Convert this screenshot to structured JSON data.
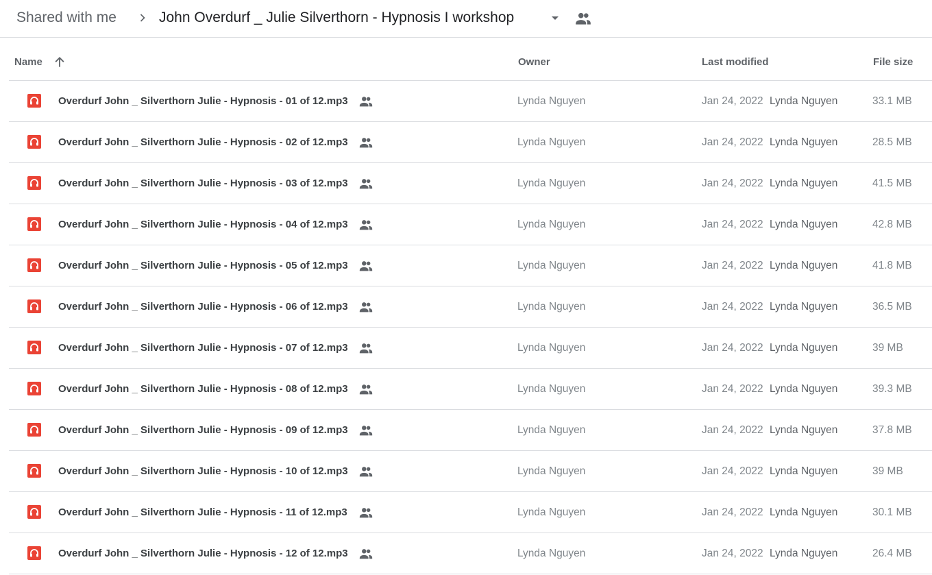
{
  "breadcrumb": {
    "root": "Shared with me",
    "current": "John Overdurf _ Julie Silverthorn - Hypnosis I workshop",
    "separator_icon": "chevron-right-icon",
    "dropdown_icon": "arrow-drop-down-icon",
    "shared_icon": "people-icon"
  },
  "columns": {
    "name": "Name",
    "owner": "Owner",
    "last_modified": "Last modified",
    "file_size": "File size",
    "sort_icon": "arrow-up-icon"
  },
  "colors": {
    "audio_icon": "#ea4335",
    "divider": "#dadce0"
  },
  "files": [
    {
      "name": "Overdurf John _ Silverthorn Julie - Hypnosis - 01 of 12.mp3",
      "owner": "Lynda Nguyen",
      "date": "Jan 24, 2022",
      "modified_by": "Lynda Nguyen",
      "size": "33.1 MB"
    },
    {
      "name": "Overdurf John _ Silverthorn Julie - Hypnosis - 02 of 12.mp3",
      "owner": "Lynda Nguyen",
      "date": "Jan 24, 2022",
      "modified_by": "Lynda Nguyen",
      "size": "28.5 MB"
    },
    {
      "name": "Overdurf John _ Silverthorn Julie - Hypnosis - 03 of 12.mp3",
      "owner": "Lynda Nguyen",
      "date": "Jan 24, 2022",
      "modified_by": "Lynda Nguyen",
      "size": "41.5 MB"
    },
    {
      "name": "Overdurf John _ Silverthorn Julie - Hypnosis - 04 of 12.mp3",
      "owner": "Lynda Nguyen",
      "date": "Jan 24, 2022",
      "modified_by": "Lynda Nguyen",
      "size": "42.8 MB"
    },
    {
      "name": "Overdurf John _ Silverthorn Julie - Hypnosis - 05 of 12.mp3",
      "owner": "Lynda Nguyen",
      "date": "Jan 24, 2022",
      "modified_by": "Lynda Nguyen",
      "size": "41.8 MB"
    },
    {
      "name": "Overdurf John _ Silverthorn Julie - Hypnosis - 06 of 12.mp3",
      "owner": "Lynda Nguyen",
      "date": "Jan 24, 2022",
      "modified_by": "Lynda Nguyen",
      "size": "36.5 MB"
    },
    {
      "name": "Overdurf John _ Silverthorn Julie - Hypnosis - 07 of 12.mp3",
      "owner": "Lynda Nguyen",
      "date": "Jan 24, 2022",
      "modified_by": "Lynda Nguyen",
      "size": "39 MB"
    },
    {
      "name": "Overdurf John _ Silverthorn Julie - Hypnosis - 08 of 12.mp3",
      "owner": "Lynda Nguyen",
      "date": "Jan 24, 2022",
      "modified_by": "Lynda Nguyen",
      "size": "39.3 MB"
    },
    {
      "name": "Overdurf John _ Silverthorn Julie - Hypnosis - 09 of 12.mp3",
      "owner": "Lynda Nguyen",
      "date": "Jan 24, 2022",
      "modified_by": "Lynda Nguyen",
      "size": "37.8 MB"
    },
    {
      "name": "Overdurf John _ Silverthorn Julie - Hypnosis - 10 of 12.mp3",
      "owner": "Lynda Nguyen",
      "date": "Jan 24, 2022",
      "modified_by": "Lynda Nguyen",
      "size": "39 MB"
    },
    {
      "name": "Overdurf John _ Silverthorn Julie - Hypnosis - 11 of 12.mp3",
      "owner": "Lynda Nguyen",
      "date": "Jan 24, 2022",
      "modified_by": "Lynda Nguyen",
      "size": "30.1 MB"
    },
    {
      "name": "Overdurf John _ Silverthorn Julie - Hypnosis - 12 of 12.mp3",
      "owner": "Lynda Nguyen",
      "date": "Jan 24, 2022",
      "modified_by": "Lynda Nguyen",
      "size": "26.4 MB"
    }
  ]
}
